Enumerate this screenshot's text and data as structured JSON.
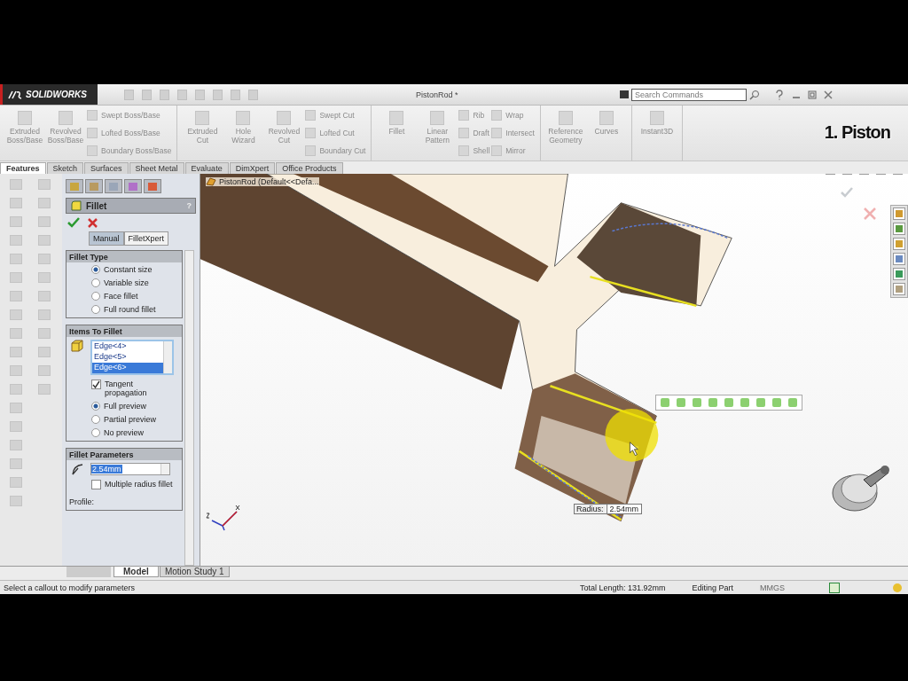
{
  "app": {
    "logo": "SOLIDWORKS",
    "title": "PistonRod *",
    "search": {
      "placeholder": "Search Commands"
    }
  },
  "ribbon": {
    "groups": [
      {
        "items": [
          {
            "kind": "large",
            "label": "Extruded Boss/Base"
          },
          {
            "kind": "large",
            "label": "Revolved Boss/Base"
          },
          {
            "kind": "stack",
            "labels": [
              "Swept Boss/Base",
              "Lofted Boss/Base",
              "Boundary Boss/Base"
            ]
          }
        ]
      },
      {
        "items": [
          {
            "kind": "large",
            "label": "Extruded Cut"
          },
          {
            "kind": "large",
            "label": "Hole Wizard"
          },
          {
            "kind": "large",
            "label": "Revolved Cut"
          },
          {
            "kind": "stack",
            "labels": [
              "Swept Cut",
              "Lofted Cut",
              "Boundary Cut"
            ]
          }
        ]
      },
      {
        "items": [
          {
            "kind": "large",
            "label": "Fillet"
          },
          {
            "kind": "large",
            "label": "Linear Pattern"
          },
          {
            "kind": "stack",
            "labels": [
              "Rib",
              "Draft",
              "Shell"
            ]
          },
          {
            "kind": "stack",
            "labels": [
              "Wrap",
              "Intersect",
              "Mirror"
            ]
          }
        ]
      },
      {
        "items": [
          {
            "kind": "large",
            "label": "Reference Geometry"
          },
          {
            "kind": "large",
            "label": "Curves"
          }
        ]
      },
      {
        "items": [
          {
            "kind": "large",
            "label": "Instant3D"
          }
        ]
      }
    ],
    "overlay_title": "1. Piston"
  },
  "tabs": [
    {
      "label": "Features",
      "selected": true
    },
    {
      "label": "Sketch",
      "selected": false
    },
    {
      "label": "Surfaces",
      "selected": false
    },
    {
      "label": "Sheet Metal",
      "selected": false
    },
    {
      "label": "Evaluate",
      "selected": false
    },
    {
      "label": "DimXpert",
      "selected": false
    },
    {
      "label": "Office Products",
      "selected": false
    }
  ],
  "property_manager": {
    "title": "Fillet",
    "help": "?",
    "modes": [
      {
        "label": "Manual",
        "selected": true
      },
      {
        "label": "FilletXpert",
        "selected": false
      }
    ],
    "sections": [
      {
        "title": "Fillet Type",
        "items": [
          {
            "kind": "radio",
            "label": "Constant size",
            "selected": true
          },
          {
            "kind": "radio",
            "label": "Variable size",
            "selected": false
          },
          {
            "kind": "radio",
            "label": "Face fillet",
            "selected": false
          },
          {
            "kind": "radio",
            "label": "Full round fillet",
            "selected": false
          }
        ]
      },
      {
        "title": "Items To Fillet",
        "items": [
          {
            "kind": "list",
            "entries": [
              {
                "label": "Edge<4>",
                "selected": false
              },
              {
                "label": "Edge<5>",
                "selected": false
              },
              {
                "label": "Edge<6>",
                "selected": true
              }
            ]
          },
          {
            "kind": "checkbox",
            "label": "Tangent propagation",
            "checked": true
          },
          {
            "kind": "radio",
            "label": "Full preview",
            "selected": true
          },
          {
            "kind": "radio",
            "label": "Partial preview",
            "selected": false
          },
          {
            "kind": "radio",
            "label": "No preview",
            "selected": false
          }
        ]
      },
      {
        "title": "Fillet Parameters",
        "items": [
          {
            "kind": "field",
            "value": "2.54mm"
          },
          {
            "kind": "checkbox",
            "label": "Multiple radius fillet",
            "checked": false
          },
          {
            "kind": "label",
            "label": "Profile:"
          }
        ]
      }
    ]
  },
  "viewport": {
    "tree_label": "PistonRod  (Default<<Defa...",
    "callout": {
      "label": "Radius:",
      "value": "2.54mm"
    }
  },
  "bottom_tabs": [
    {
      "label": "Model",
      "selected": true
    },
    {
      "label": "Motion Study 1",
      "selected": false
    }
  ],
  "status_bar": {
    "message": "Select a callout to modify parameters",
    "length": "Total Length: 131.92mm",
    "mode": "Editing Part",
    "units": "MMGS"
  }
}
